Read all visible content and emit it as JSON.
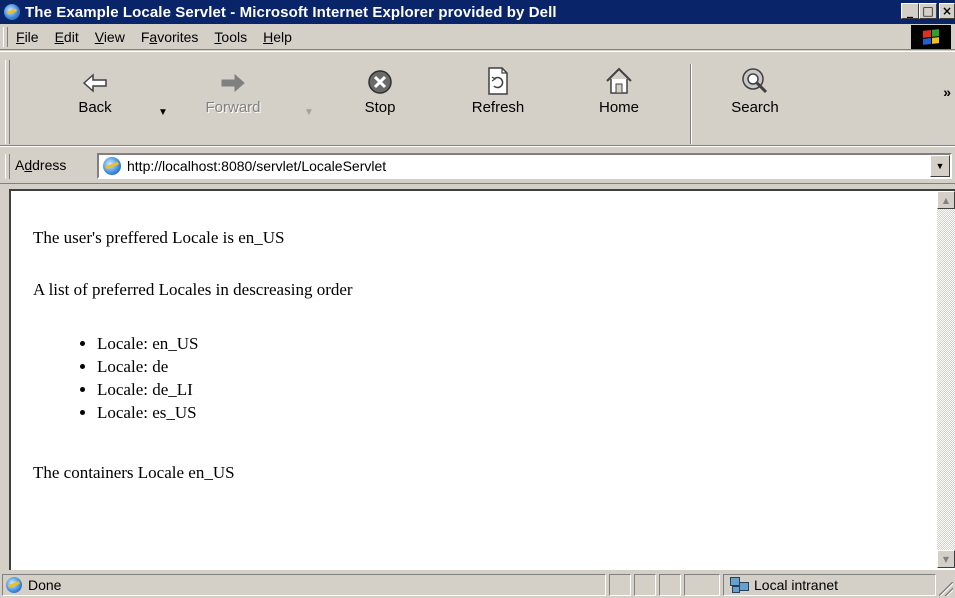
{
  "window": {
    "title": "The Example Locale Servlet - Microsoft Internet Explorer provided by Dell",
    "minimize_label": "_",
    "maximize_label": "□",
    "close_label": "×"
  },
  "menu": {
    "items": [
      {
        "accel": "F",
        "rest": "ile"
      },
      {
        "accel": "E",
        "rest": "dit"
      },
      {
        "accel": "V",
        "rest": "iew"
      },
      {
        "pre": "F",
        "accel": "a",
        "rest": "vorites"
      },
      {
        "accel": "T",
        "rest": "ools"
      },
      {
        "accel": "H",
        "rest": "elp"
      }
    ]
  },
  "toolbar": {
    "back": "Back",
    "forward": "Forward",
    "stop": "Stop",
    "refresh": "Refresh",
    "home": "Home",
    "search": "Search",
    "more": "»"
  },
  "address": {
    "label_pre": "A",
    "label_accel": "d",
    "label_rest": "dress",
    "url": "http://localhost:8080/servlet/LocaleServlet"
  },
  "page": {
    "preferred_locale_text": "The user's preffered Locale is en_US",
    "list_heading": "A list of preferred Locales in descreasing order",
    "locales": [
      "Locale: en_US",
      "Locale: de",
      "Locale: de_LI",
      "Locale: es_US"
    ],
    "container_locale_text": "The containers Locale en_US"
  },
  "status": {
    "text": "Done",
    "zone": "Local intranet"
  },
  "colors": {
    "titlebar": "#0a246a",
    "chrome": "#d4d0c8",
    "content_bg": "#ffffff"
  }
}
